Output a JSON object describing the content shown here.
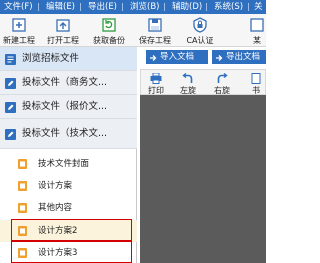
{
  "menu": {
    "items": [
      "文件(F)",
      "编辑(E)",
      "导出(E)",
      "浏览(B)",
      "辅助(D)",
      "系统(S)",
      "关"
    ]
  },
  "toolbar": {
    "buttons": [
      {
        "label": "新建工程",
        "icon": "new-project-icon"
      },
      {
        "label": "打开工程",
        "icon": "open-project-icon"
      },
      {
        "label": "获取备份",
        "icon": "backup-icon"
      },
      {
        "label": "保存工程",
        "icon": "save-project-icon"
      },
      {
        "label": "CA认证",
        "icon": "ca-cert-icon"
      },
      {
        "label": "某",
        "icon": "more-icon"
      }
    ]
  },
  "sidebar": {
    "browse_label": "浏览招标文件",
    "sections": [
      {
        "label": "投标文件（商务文..."
      },
      {
        "label": "投标文件（报价文..."
      },
      {
        "label": "投标文件（技术文..."
      }
    ],
    "items": [
      {
        "label": "技术文件封面"
      },
      {
        "label": "设计方案"
      },
      {
        "label": "其他内容"
      },
      {
        "label": "设计方案2"
      },
      {
        "label": "设计方案3"
      }
    ],
    "highlight_color": "#d40000"
  },
  "right": {
    "import_button": "导入文档",
    "export_button": "导出文档",
    "viewer_tools": [
      {
        "label": "打印",
        "icon": "print-icon"
      },
      {
        "label": "左旋",
        "icon": "rotate-left-icon"
      },
      {
        "label": "右旋",
        "icon": "rotate-right-icon"
      },
      {
        "label": "书",
        "icon": "bookmark-icon"
      }
    ]
  },
  "colors": {
    "accent": "#2f6fbf",
    "viewer_background": "#5b5b5b"
  }
}
